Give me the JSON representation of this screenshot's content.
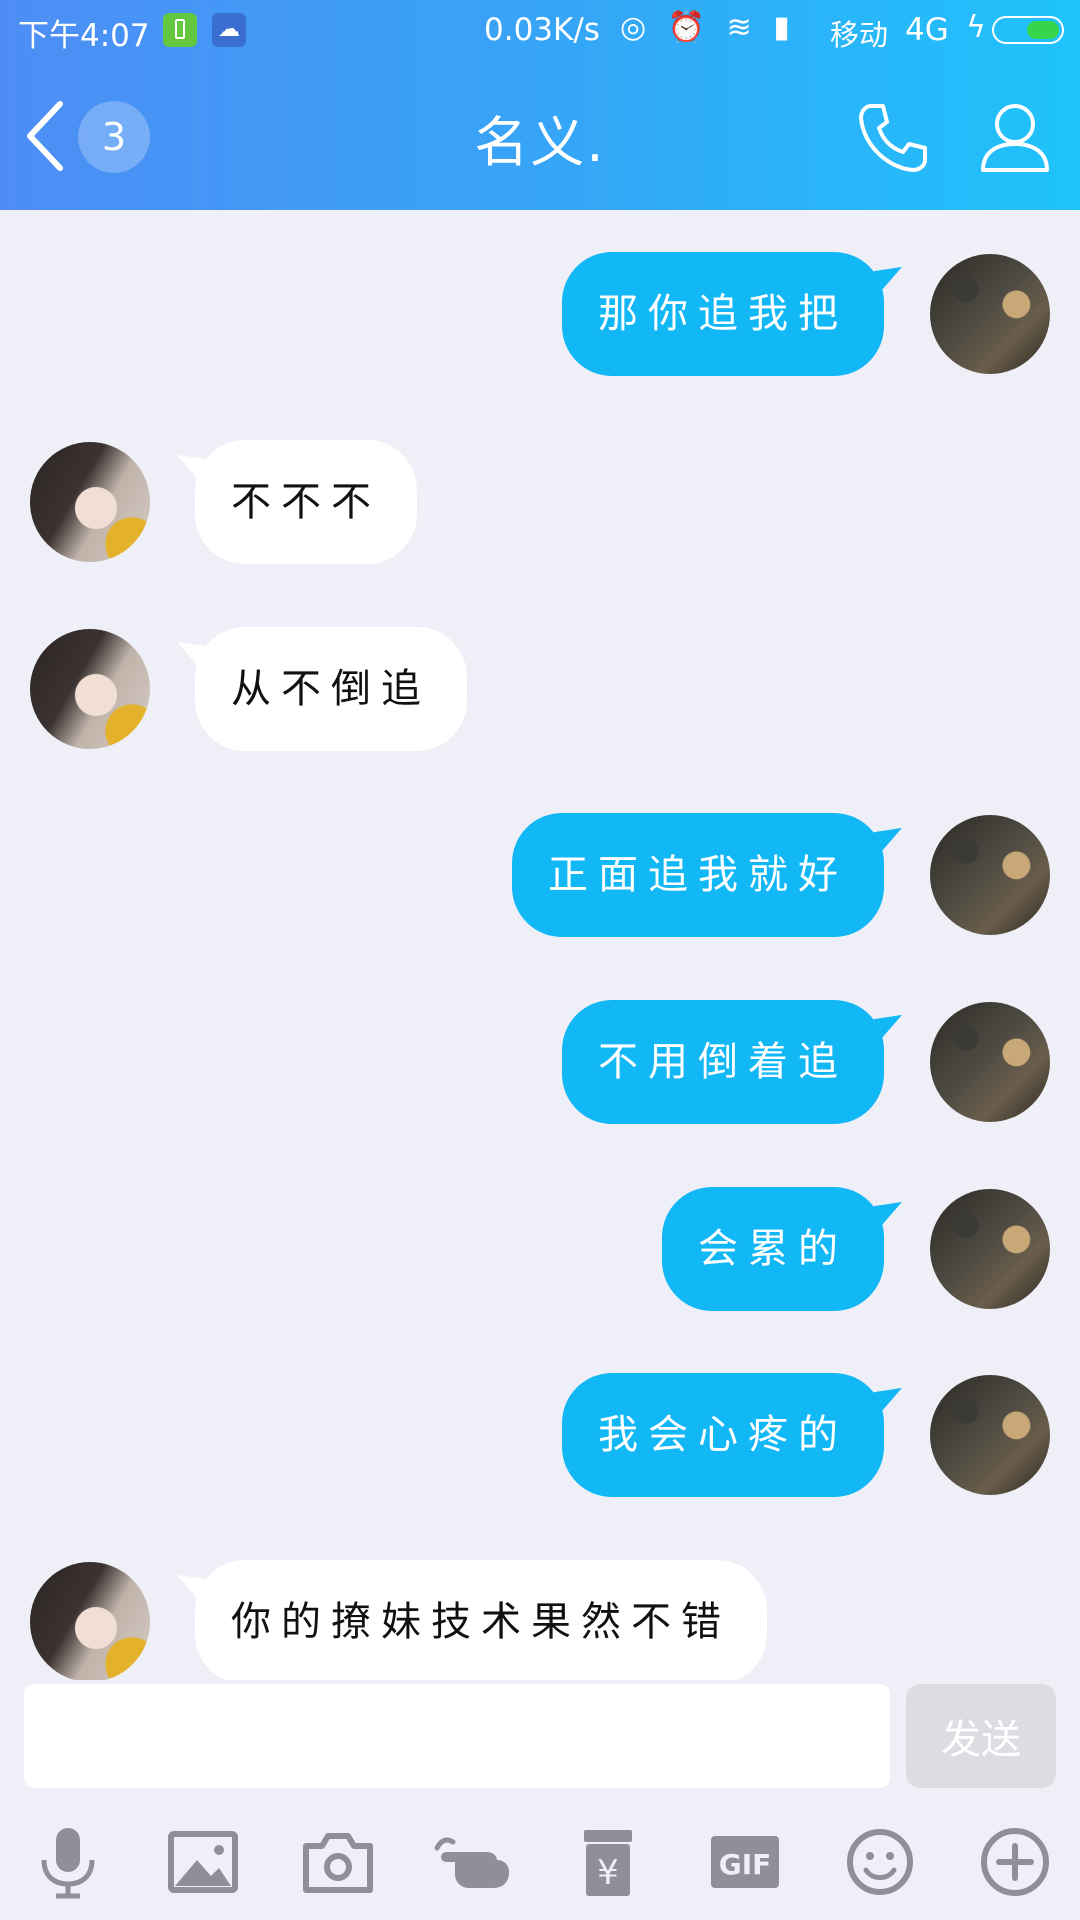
{
  "status_bar": {
    "time": "下午4:07",
    "net_speed": "0.03K/s",
    "glyphs": "◎ ⏰ ≋ ▮",
    "carrier": "移动",
    "network": "4G",
    "charging": "ϟ",
    "cloud_glyph": "☁"
  },
  "header": {
    "title": "名义.",
    "unread_count": "3",
    "icons": [
      "back-icon",
      "phone-icon",
      "profile-icon"
    ]
  },
  "messages": [
    {
      "sender": "me",
      "text": "那你追我把"
    },
    {
      "sender": "them",
      "text": "不不不"
    },
    {
      "sender": "them",
      "text": "从不倒追"
    },
    {
      "sender": "me",
      "text": "正面追我就好"
    },
    {
      "sender": "me",
      "text": "不用倒着追"
    },
    {
      "sender": "me",
      "text": "会累的"
    },
    {
      "sender": "me",
      "text": "我会心疼的"
    },
    {
      "sender": "them",
      "text": "你的撩妹技术果然不错"
    }
  ],
  "input": {
    "value": "",
    "send_label": "发送"
  },
  "toolbar": {
    "items": [
      "microphone-icon",
      "image-icon",
      "camera-icon",
      "poke-hand-icon",
      "red-packet-icon",
      "gif-icon",
      "emoji-icon",
      "plus-icon"
    ],
    "gif_label": "GIF",
    "red_packet_symbol": "¥"
  },
  "colors": {
    "header_gradient_start": "#4e8df5",
    "header_gradient_end": "#1fc3fb",
    "my_bubble": "#12b7f5",
    "their_bubble": "#ffffff",
    "background": "#eff0f7",
    "icon_gray": "#8e8f99"
  }
}
